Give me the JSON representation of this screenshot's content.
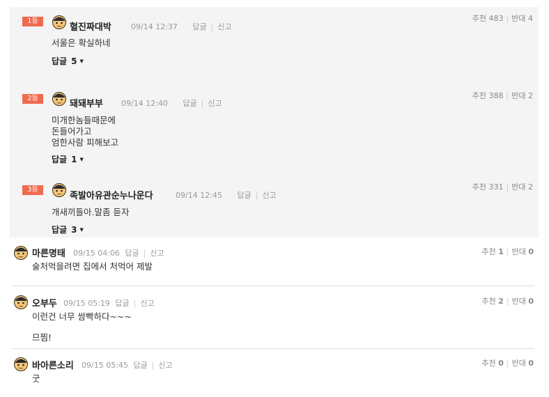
{
  "best_comments": [
    {
      "rank": "1등",
      "author": "혈진짜대박",
      "date": "09/14 12:37",
      "reply_action": "답글",
      "report_action": "신고",
      "up_label": "추천",
      "up_count": "483",
      "down_label": "반대",
      "down_count": "4",
      "lines": [
        "서울은 확실하네"
      ],
      "reply_label": "답글",
      "reply_count": "5"
    },
    {
      "rank": "2등",
      "author": "돼돼부부",
      "date": "09/14 12:40",
      "reply_action": "답글",
      "report_action": "신고",
      "up_label": "추천",
      "up_count": "388",
      "down_label": "반대",
      "down_count": "2",
      "lines": [
        "미개한놈들때문에",
        "돈들어가고",
        "엄한사람 피해보고"
      ],
      "reply_label": "답글",
      "reply_count": "1"
    },
    {
      "rank": "3등",
      "author": "족발아유관순누나운다",
      "date": "09/14 12:45",
      "reply_action": "답글",
      "report_action": "신고",
      "up_label": "추천",
      "up_count": "331",
      "down_label": "반대",
      "down_count": "2",
      "lines": [
        "개새끼들아.말좀 듣자"
      ],
      "reply_label": "답글",
      "reply_count": "3"
    }
  ],
  "comments": [
    {
      "author": "마른명태",
      "date": "09/15 04:06",
      "reply_action": "답글",
      "report_action": "신고",
      "up_label": "추천",
      "up_count": "1",
      "down_label": "반대",
      "down_count": "0",
      "lines": [
        "술처먹을려면 집에서 처먹어 제발"
      ]
    },
    {
      "author": "오부두",
      "date": "09/15 05:19",
      "reply_action": "답글",
      "report_action": "신고",
      "up_label": "추천",
      "up_count": "2",
      "down_label": "반대",
      "down_count": "0",
      "lines": [
        "이런건 너무 쌈빡하다~~~",
        "",
        "므찜!"
      ]
    },
    {
      "author": "바아른소리",
      "date": "09/15 05:45",
      "reply_action": "답글",
      "report_action": "신고",
      "up_label": "추천",
      "up_count": "0",
      "down_label": "반대",
      "down_count": "0",
      "lines": [
        "굿"
      ]
    }
  ],
  "colors": {
    "rank_badge": "#f06a4d",
    "best_bg": "#f4f4f4"
  },
  "icons": {
    "avatar": "smiley-face-icon",
    "reply_toggle": "caret-down-icon"
  }
}
